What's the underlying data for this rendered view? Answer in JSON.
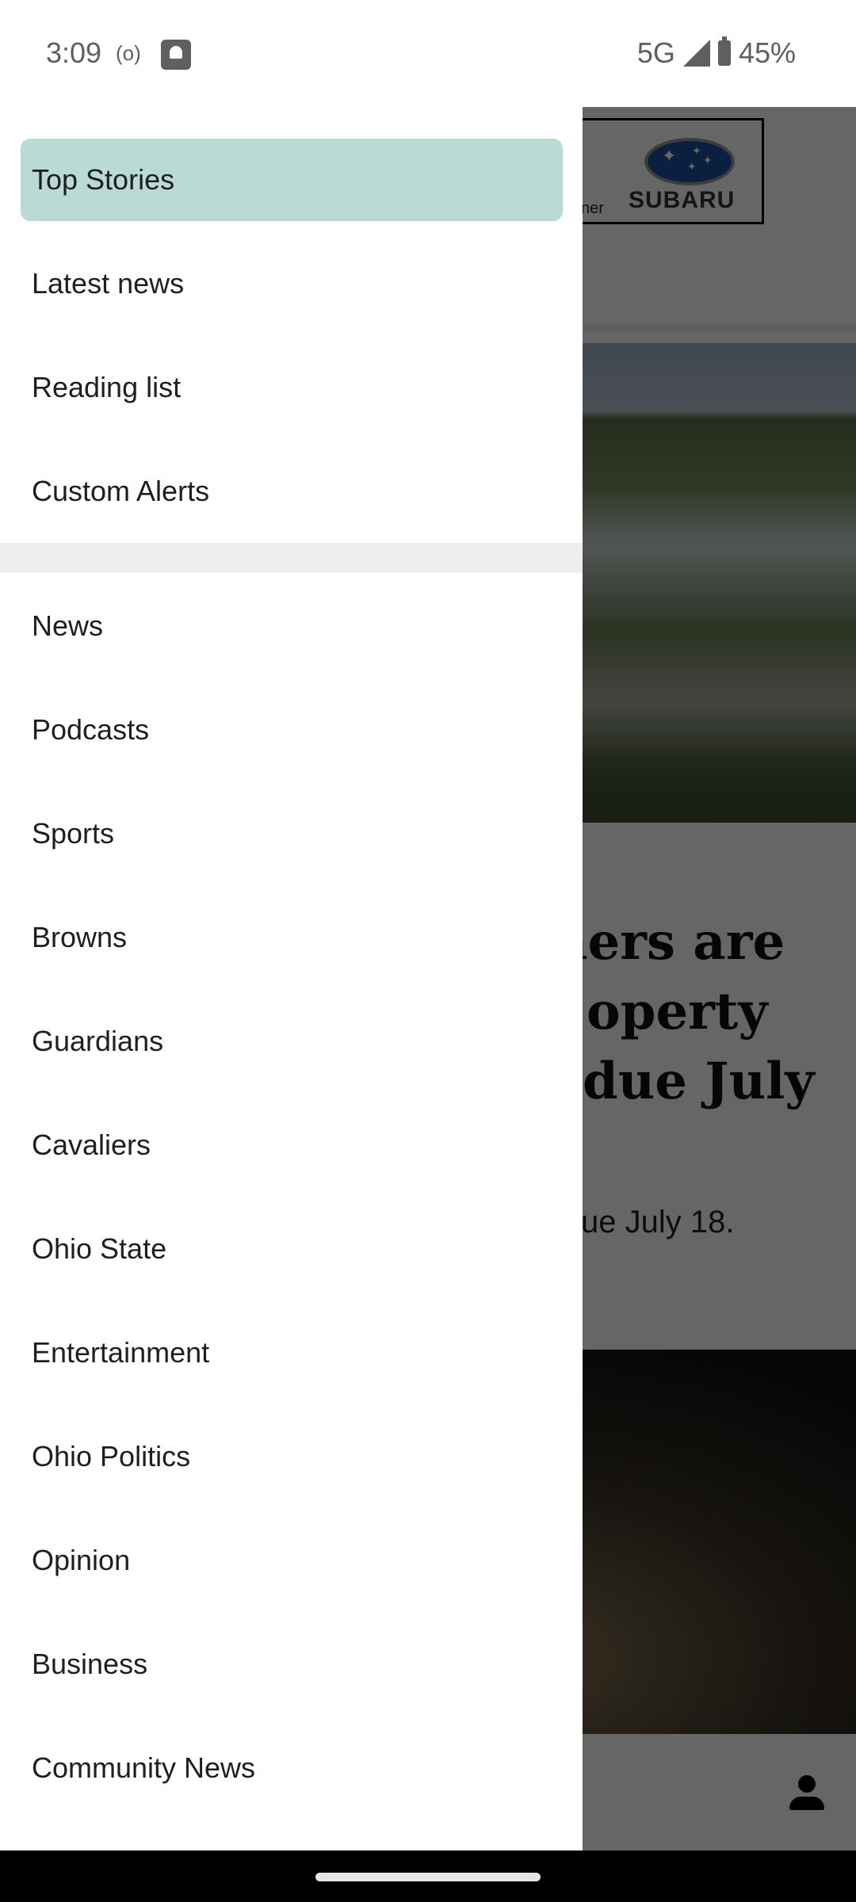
{
  "status_bar": {
    "time": "3:09",
    "radio_indicator": "(o)",
    "network": "5G",
    "battery": "45%",
    "icons": [
      "hotspot-icon",
      "app-notification-icon",
      "signal-icon",
      "battery-icon"
    ]
  },
  "drawer": {
    "primary_items": [
      {
        "label": "Top Stories",
        "active": true
      },
      {
        "label": "Latest news",
        "active": false
      },
      {
        "label": "Reading list",
        "active": false
      },
      {
        "label": "Custom Alerts",
        "active": false
      }
    ],
    "section_items": [
      {
        "label": "News"
      },
      {
        "label": "Podcasts"
      },
      {
        "label": "Sports"
      },
      {
        "label": "Browns"
      },
      {
        "label": "Guardians"
      },
      {
        "label": "Cavaliers"
      },
      {
        "label": "Ohio State"
      },
      {
        "label": "Entertainment"
      },
      {
        "label": "Ohio Politics"
      },
      {
        "label": "Opinion"
      },
      {
        "label": "Business"
      },
      {
        "label": "Community News"
      }
    ],
    "active_color": "#badbd5"
  },
  "background": {
    "ad": {
      "sponsor_text_visible": "ner",
      "brand": "SUBARU"
    },
    "headline_visible": [
      "ners are",
      "operty",
      "due July"
    ],
    "summary_visible": "ue July 18.",
    "bottom_nav": {
      "account_icon": "account-icon"
    }
  }
}
